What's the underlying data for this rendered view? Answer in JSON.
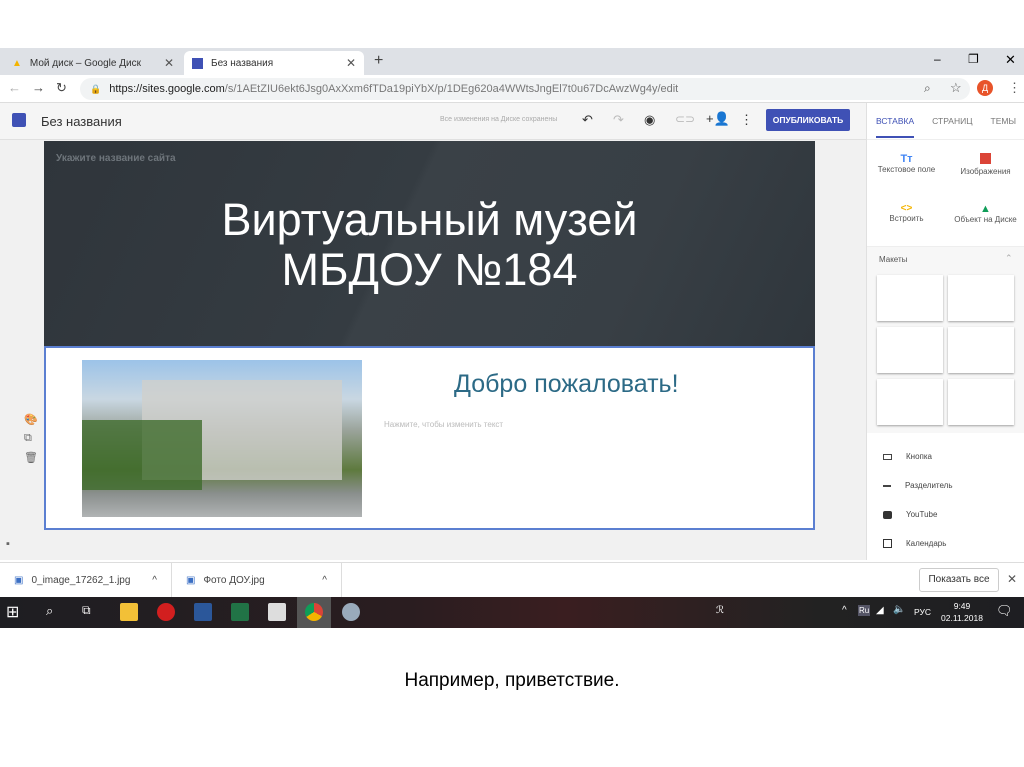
{
  "browser": {
    "tabs": [
      {
        "label": "Мой диск – Google Диск"
      },
      {
        "label": "Без названия"
      }
    ],
    "url_host": "https://sites.google.com",
    "url_path": "/s/1AEtZIU6ekt6Jsg0AxXxm6fTDa19piYbX/p/1DEg620a4WWtsJngEl7t0u67DcAwzWg4y/edit",
    "avatar": "Д"
  },
  "editor": {
    "title": "Без названия",
    "saved_status": "Все изменения на Диске сохранены",
    "publish": "ОПУБЛИКОВАТЬ",
    "site_name_placeholder": "Укажите название сайта",
    "header_title_line1": "Виртуальный музей",
    "header_title_line2": "МБДОУ №184",
    "welcome": "Добро пожаловать!",
    "text_placeholder": "Нажмите, чтобы изменить текст"
  },
  "panel": {
    "tabs": [
      "ВСТАВКА",
      "СТРАНИЦ",
      "ТЕМЫ"
    ],
    "insert": [
      "Текстовое поле",
      "Изображения",
      "Встроить",
      "Объект на Диске"
    ],
    "layouts_label": "Макеты",
    "items": [
      "Кнопка",
      "Разделитель",
      "YouTube",
      "Календарь"
    ]
  },
  "downloads": {
    "files": [
      "0_image_17262_1.jpg",
      "Фото ДОУ.jpg"
    ],
    "show_all": "Показать все"
  },
  "taskbar": {
    "lang": "РУС",
    "time": "9:49",
    "date": "02.11.2018"
  },
  "caption": "Например, приветствие.",
  "colors": {
    "accent": "#3f51b5",
    "header": "#33393f",
    "welcome": "#2c6a86"
  }
}
